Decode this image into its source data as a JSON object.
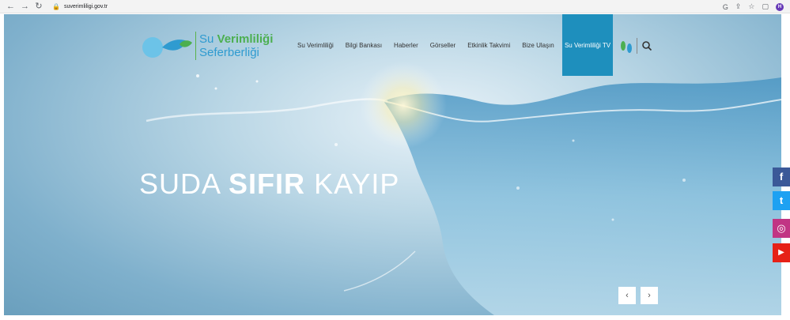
{
  "browser": {
    "url": "suverimliligi.gov.tr",
    "avatar_letter": "H",
    "icons": [
      "back-icon",
      "forward-icon",
      "reload-icon",
      "lock-icon",
      "google-translate-icon",
      "share-icon",
      "star-icon",
      "sidebar-icon"
    ]
  },
  "logo": {
    "line1_a": "Su ",
    "line1_b": "Verimliliği",
    "line2": "Seferberliği"
  },
  "menu": {
    "items": [
      {
        "label": "Su Verimliliği"
      },
      {
        "label": "Bilgi Bankası"
      },
      {
        "label": "Haberler"
      },
      {
        "label": "Görseller"
      },
      {
        "label": "Etkinlik Takvimi"
      },
      {
        "label": "Bize Ulaşın"
      }
    ],
    "tv_label": "Su Verimliliği TV"
  },
  "hero": {
    "title_a": "SUDA ",
    "title_b": "SIFIR",
    "title_c": " KAYIP",
    "prev": "‹",
    "next": "›"
  },
  "social": [
    {
      "name": "facebook",
      "glyph": "f",
      "color": "#3b5998"
    },
    {
      "name": "twitter",
      "glyph": "t",
      "color": "#1da1f2"
    },
    {
      "name": "instagram",
      "glyph": "◎",
      "color": "#c13584"
    },
    {
      "name": "youtube",
      "glyph": "▶",
      "color": "#e62117"
    }
  ],
  "colors": {
    "accent": "#1e8fbd",
    "logo_blue": "#2f9bd0",
    "logo_green": "#4caf50"
  }
}
